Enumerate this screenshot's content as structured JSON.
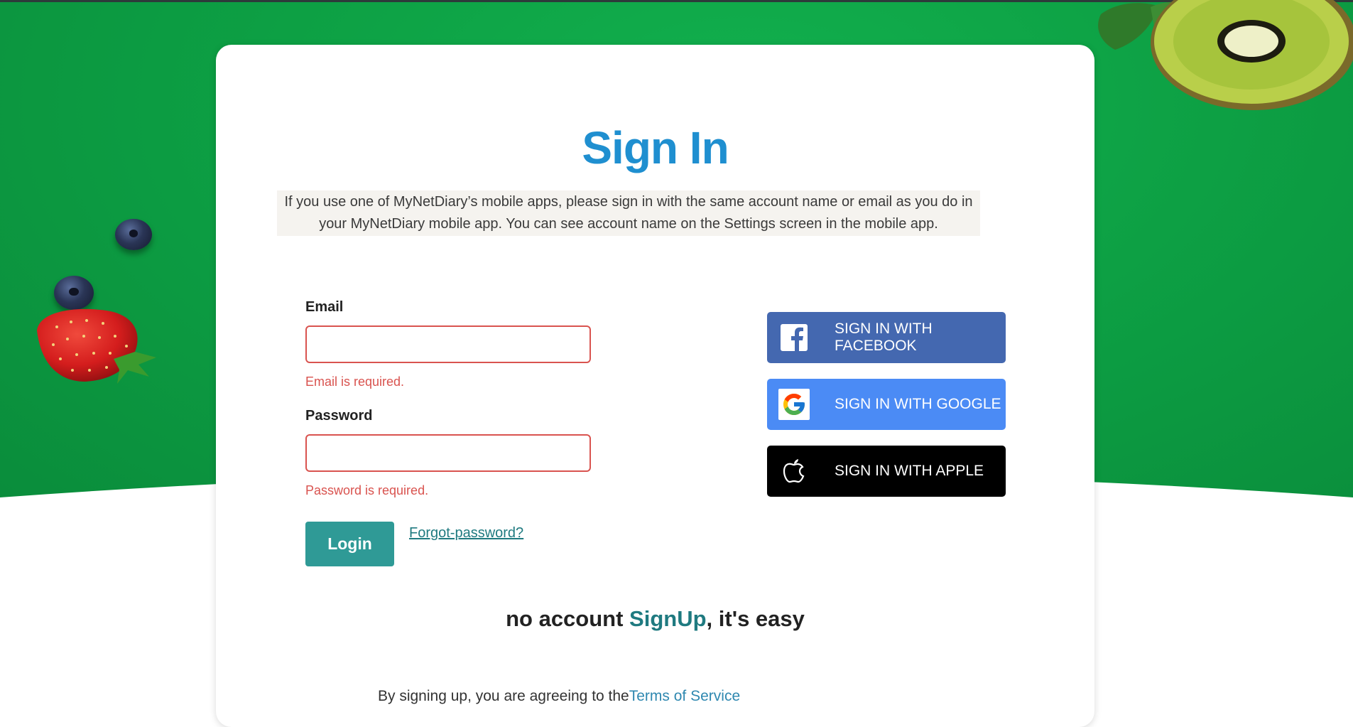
{
  "page": {
    "title": "Sign In",
    "notice": "If you use one of MyNetDiary’s mobile apps, please sign in with the same account name or email as you do in your MyNetDiary mobile app. You can see account name on the Settings screen in the mobile app."
  },
  "form": {
    "email_label": "Email",
    "email_value": "",
    "email_error": "Email is required.",
    "password_label": "Password",
    "password_value": "",
    "password_error": "Password is required.",
    "login_label": "Login",
    "forgot_label": "Forgot-password?"
  },
  "social": {
    "facebook_label": "SIGN IN WITH FACEBOOK",
    "google_label": "SIGN IN WITH GOOGLE",
    "apple_label": "SIGN IN WITH APPLE"
  },
  "signup": {
    "prefix": "no account ",
    "link": "SignUp",
    "suffix": ", it's easy"
  },
  "terms": {
    "prefix": "By signing up, you are agreeing to the",
    "link": "Terms of Service"
  },
  "colors": {
    "background_green": "#0da044",
    "title_blue": "#1f8fd0",
    "error_red": "#d9534f",
    "login_teal": "#2f9a96",
    "facebook_blue": "#4468b0",
    "google_blue": "#4b8bf5",
    "apple_black": "#000000"
  },
  "icons": {
    "facebook": "facebook-icon",
    "google": "google-icon",
    "apple": "apple-icon"
  }
}
